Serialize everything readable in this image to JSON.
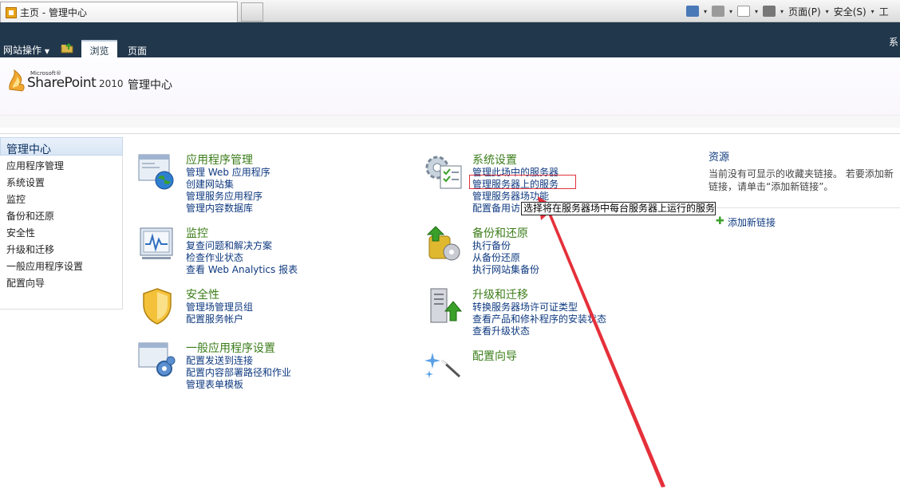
{
  "browser": {
    "tab_title": "主页 - 管理中心",
    "toolbar": {
      "page_menu": "页面(P)",
      "safety_menu": "安全(S)",
      "tools_cut": "工"
    }
  },
  "ribbon": {
    "site_actions": "网站操作",
    "browse_tab": "浏览",
    "page_tab": "页面",
    "right_cut": "系"
  },
  "header": {
    "logo_microsoft": "Microsoft®",
    "logo_product": "SharePoint",
    "logo_version": "2010",
    "site_title": "管理中心"
  },
  "leftnav": {
    "current": "管理中心",
    "items": [
      "应用程序管理",
      "系统设置",
      "监控",
      "备份和还原",
      "安全性",
      "升级和迁移",
      "一般应用程序设置",
      "配置向导"
    ]
  },
  "sections": {
    "app_mgmt": {
      "title": "应用程序管理",
      "links": [
        "管理 Web 应用程序",
        "创建网站集",
        "管理服务应用程序",
        "管理内容数据库"
      ]
    },
    "monitoring": {
      "title": "监控",
      "links": [
        "复查问题和解决方案",
        "检查作业状态",
        "查看 Web Analytics 报表"
      ]
    },
    "security": {
      "title": "安全性",
      "links": [
        "管理场管理员组",
        "配置服务帐户"
      ]
    },
    "general": {
      "title": "一般应用程序设置",
      "links": [
        "配置发送到连接",
        "配置内容部署路径和作业",
        "管理表单模板"
      ]
    },
    "system": {
      "title": "系统设置",
      "links": [
        "管理此场中的服务器",
        "管理服务器上的服务",
        "管理服务器场功能",
        "配置备用访问映射"
      ]
    },
    "backup": {
      "title": "备份和还原",
      "links": [
        "执行备份",
        "从备份还原",
        "执行网站集备份"
      ]
    },
    "upgrade": {
      "title": "升级和迁移",
      "links": [
        "转换服务器场许可证类型",
        "查看产品和修补程序的安装状态",
        "查看升级状态"
      ]
    },
    "wizard": {
      "title": "配置向导"
    }
  },
  "resources": {
    "title": "资源",
    "empty_text": "当前没有可显示的收藏夹链接。 若要添加新链接，请单击“添加新链接”。",
    "add_link": "添加新链接"
  },
  "tooltip": "选择将在服务器场中每台服务器上运行的服务",
  "colors": {
    "ribbon": "#21374c",
    "section_title": "#3c7d1a",
    "link": "#0f3a80",
    "annotation": "#e0333b"
  }
}
